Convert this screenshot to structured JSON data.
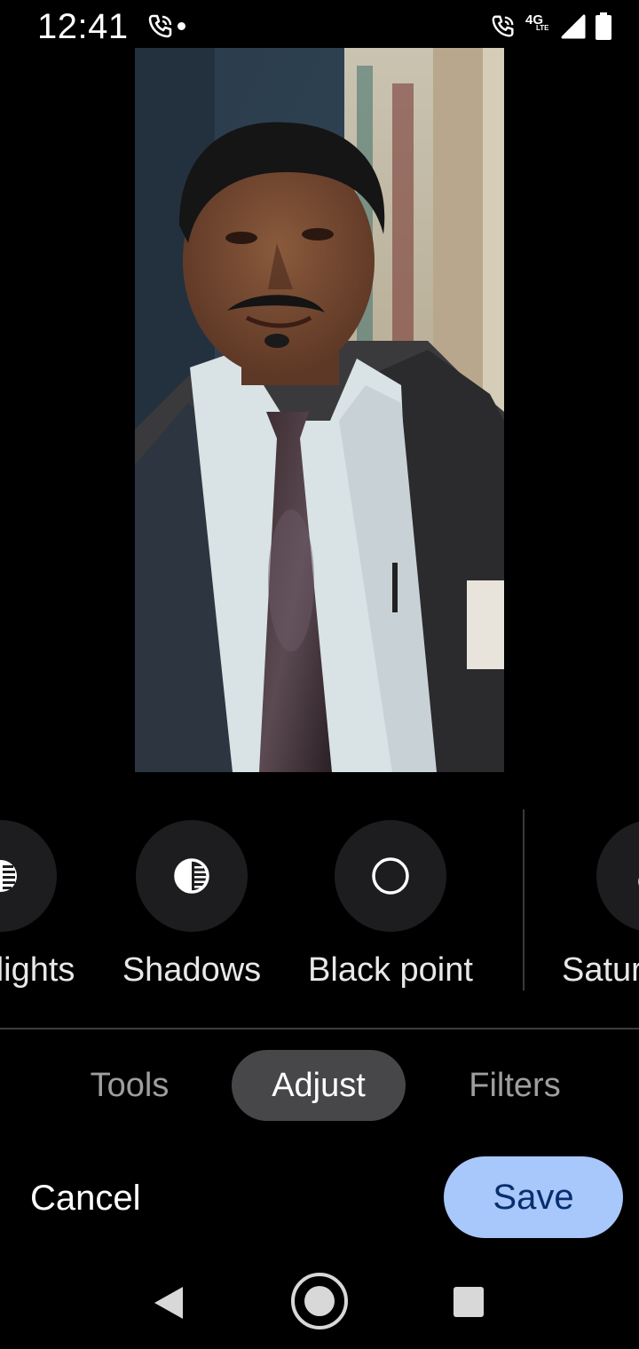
{
  "status_bar": {
    "time": "12:41",
    "left_icons": [
      "wifi-call-icon",
      "notification-dot"
    ],
    "network_label": "4G",
    "network_sublabel": "LTE",
    "right_icons": [
      "wifi-call-icon",
      "4g-lte-icon",
      "cell-signal-icon",
      "battery-icon"
    ]
  },
  "photo": {
    "description_icon": "edited-photo"
  },
  "adjust": {
    "items": [
      {
        "label": "Highlights",
        "icon": "highlights-icon"
      },
      {
        "label": "Shadows",
        "icon": "shadows-icon"
      },
      {
        "label": "Black point",
        "icon": "black-point-icon"
      },
      {
        "label": "Saturation",
        "icon": "saturation-icon"
      }
    ]
  },
  "tabs": [
    {
      "label": "Tools",
      "active": false
    },
    {
      "label": "Adjust",
      "active": true
    },
    {
      "label": "Filters",
      "active": false
    }
  ],
  "actions": {
    "cancel_label": "Cancel",
    "save_label": "Save"
  },
  "colors": {
    "background": "#000000",
    "accent": "#a8c7fa",
    "accent_text": "#062e6f",
    "active_tab": "#474749"
  },
  "nav_bar": {
    "icons": [
      "back-icon",
      "home-icon",
      "recents-icon"
    ]
  }
}
